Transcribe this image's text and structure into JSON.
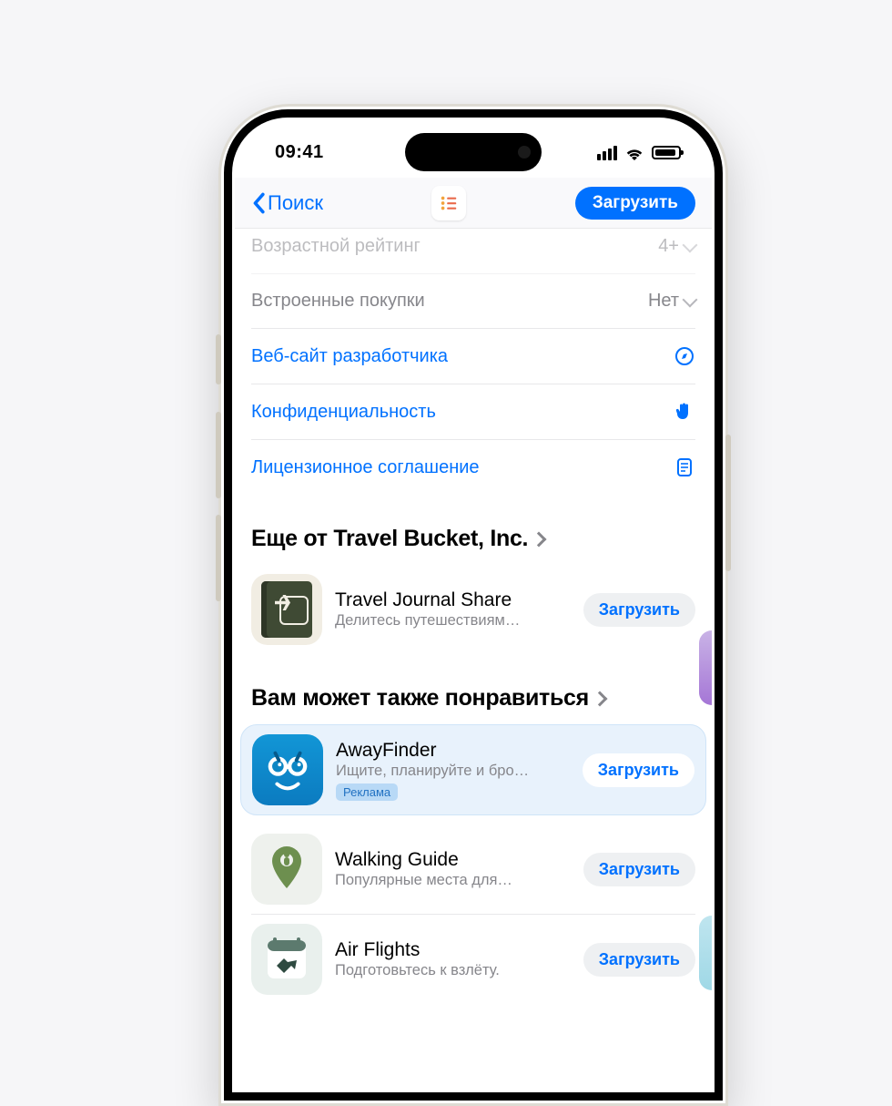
{
  "status": {
    "time": "09:41"
  },
  "nav": {
    "back_label": "Поиск",
    "download_label": "Загрузить"
  },
  "info_rows": {
    "age": {
      "label": "Возрастной рейтинг",
      "value": "4+"
    },
    "iap": {
      "label": "Встроенные покупки",
      "value": "Нет"
    },
    "site": {
      "label": "Веб-сайт разработчика"
    },
    "priv": {
      "label": "Конфиденциальность"
    },
    "lic": {
      "label": "Лицензионное соглашение"
    }
  },
  "more_section": {
    "title": "Еще от Travel Bucket, Inc.",
    "apps": [
      {
        "name": "Travel Journal Share",
        "subtitle": "Делитесь путешествиям…",
        "btn": "Загрузить"
      }
    ]
  },
  "suggest_section": {
    "title": "Вам может также понравиться",
    "apps": [
      {
        "name": "AwayFinder",
        "subtitle": "Ищите, планируйте и бро…",
        "btn": "Загрузить",
        "ad_label": "Реклама"
      },
      {
        "name": "Walking Guide",
        "subtitle": "Популярные места для…",
        "btn": "Загрузить"
      },
      {
        "name": "Air Flights",
        "subtitle": "Подготовьтесь к взлёту.",
        "btn": "Загрузить"
      }
    ]
  }
}
